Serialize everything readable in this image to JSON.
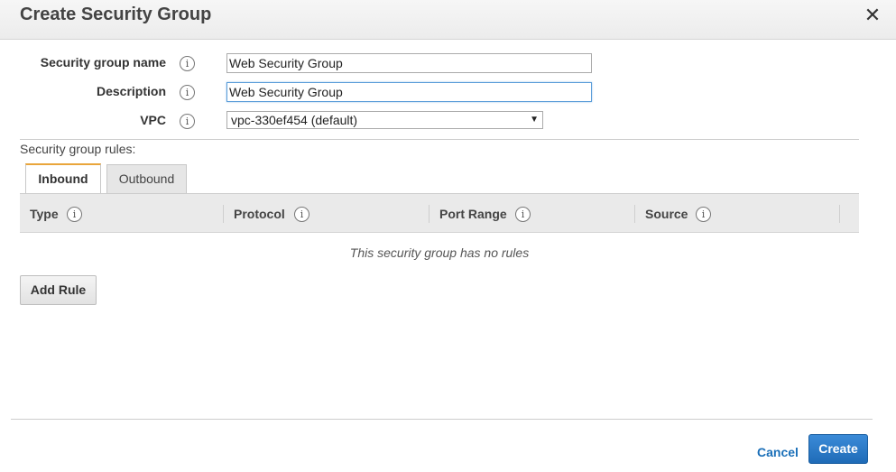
{
  "dialog": {
    "title": "Create Security Group",
    "close_glyph": "✕"
  },
  "form": {
    "name_label": "Security group name",
    "name_value": "Web Security Group",
    "description_label": "Description",
    "description_value": "Web Security Group",
    "vpc_label": "VPC",
    "vpc_value": "vpc-330ef454 (default)",
    "info_glyph": "i"
  },
  "rules": {
    "section_label": "Security group rules:",
    "tabs": [
      {
        "label": "Inbound",
        "active": true
      },
      {
        "label": "Outbound",
        "active": false
      }
    ],
    "columns": [
      "Type",
      "Protocol",
      "Port Range",
      "Source"
    ],
    "empty_message": "This security group has no rules",
    "add_rule_label": "Add Rule"
  },
  "footer": {
    "cancel_label": "Cancel",
    "create_label": "Create"
  },
  "colors": {
    "accent_tab": "#e9a53b",
    "primary_button": "#1f6bb7",
    "link": "#1a6fb8"
  }
}
